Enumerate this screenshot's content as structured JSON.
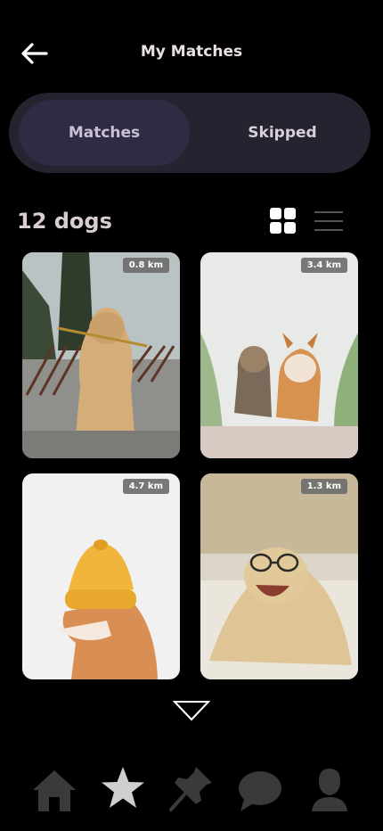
{
  "header": {
    "title": "My Matches",
    "back_icon": "arrow-left-icon"
  },
  "tabs": {
    "matches_label": "Matches",
    "skipped_label": "Skipped",
    "active": "Matches"
  },
  "results": {
    "count_label": "12 dogs",
    "view_mode": "grid"
  },
  "dogs": [
    {
      "distance": "0.8 km",
      "photo": "golden retriever puppy with flower"
    },
    {
      "distance": "3.4 km",
      "photo": "terrier and corgi running"
    },
    {
      "distance": "4.7 km",
      "photo": "shiba inu in yellow beanie"
    },
    {
      "distance": "1.3 km",
      "photo": "dog wearing glasses on bed"
    }
  ],
  "bottom_nav": [
    {
      "icon": "home-icon"
    },
    {
      "icon": "star-icon",
      "active": true
    },
    {
      "icon": "pin-icon"
    },
    {
      "icon": "chat-icon"
    },
    {
      "icon": "profile-icon"
    }
  ],
  "colors": {
    "background": "#000000",
    "segment_bg": "#25232f",
    "segment_active": "#2e2b42",
    "nav_inactive": "#3a3a3a",
    "nav_active": "#cfcfcf"
  }
}
